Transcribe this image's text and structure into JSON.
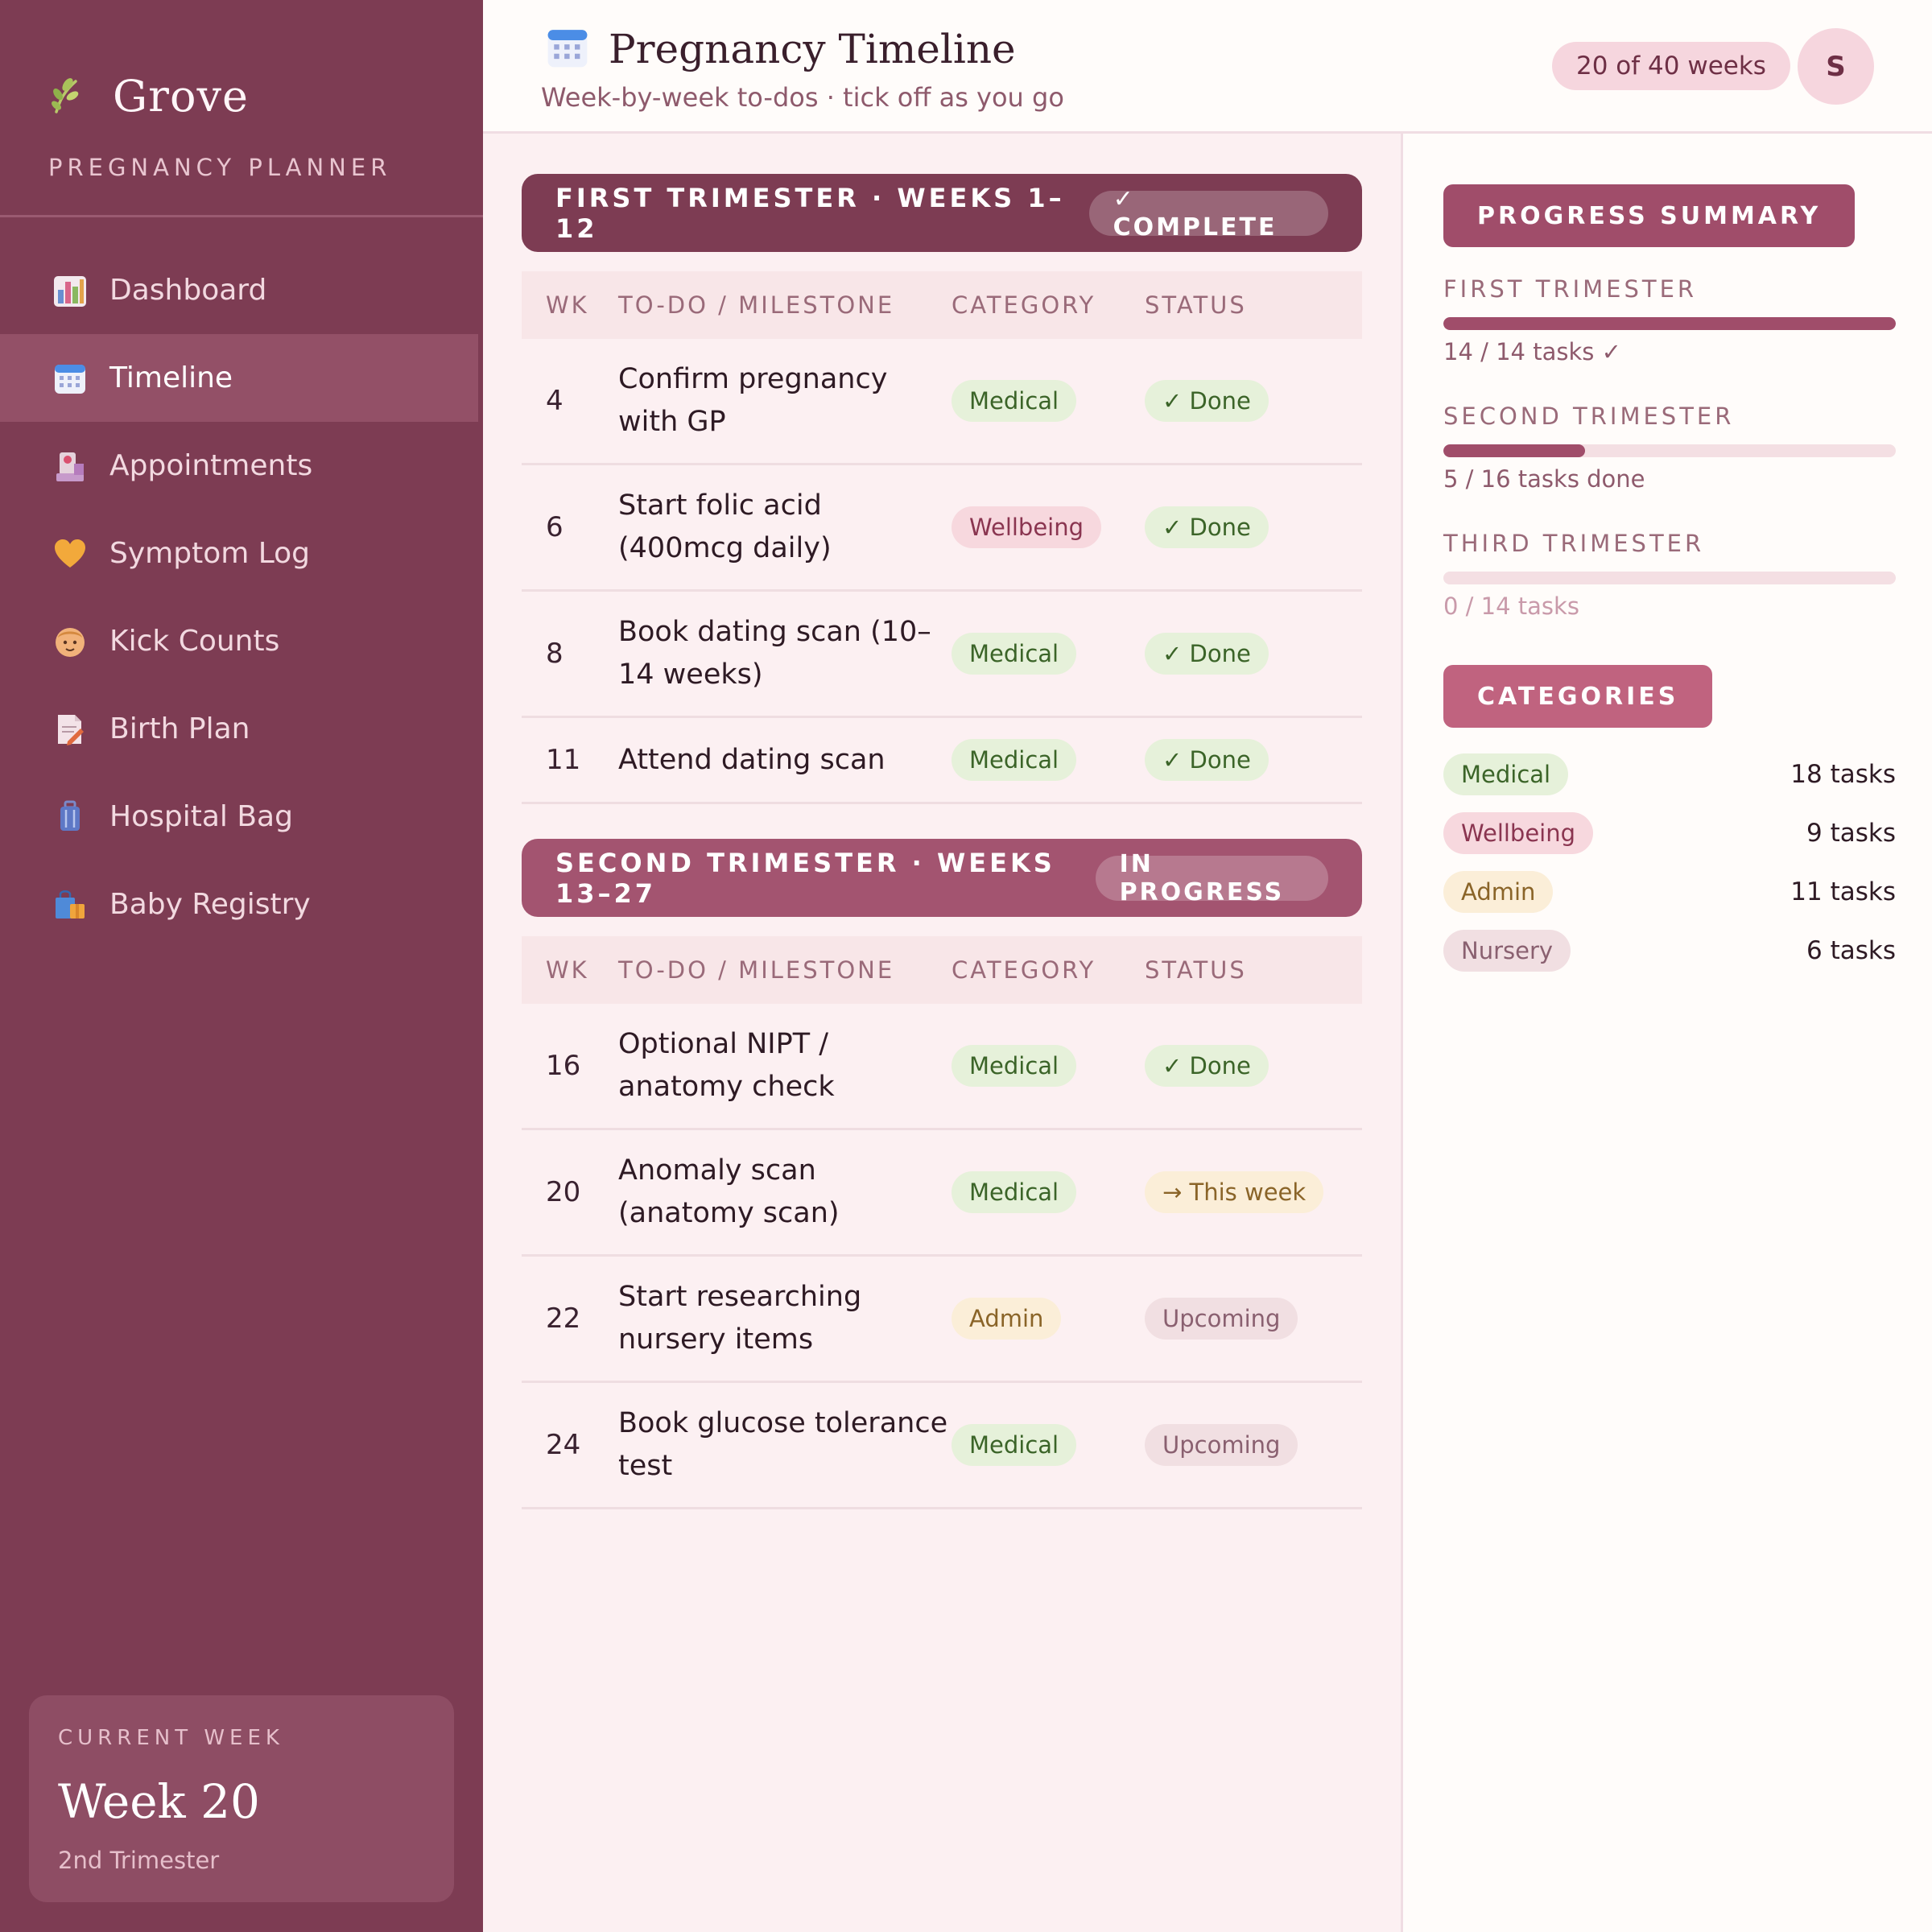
{
  "brand": {
    "name": "Grove",
    "subtitle": "PREGNANCY PLANNER"
  },
  "nav": [
    {
      "label": "Dashboard",
      "icon": "bar-chart-icon",
      "active": false
    },
    {
      "label": "Timeline",
      "icon": "calendar-icon",
      "active": true
    },
    {
      "label": "Appointments",
      "icon": "hospital-icon",
      "active": false
    },
    {
      "label": "Symptom Log",
      "icon": "heart-icon",
      "active": false
    },
    {
      "label": "Kick Counts",
      "icon": "baby-icon",
      "active": false
    },
    {
      "label": "Birth Plan",
      "icon": "memo-icon",
      "active": false
    },
    {
      "label": "Hospital Bag",
      "icon": "luggage-icon",
      "active": false
    },
    {
      "label": "Baby Registry",
      "icon": "shopping-bag-icon",
      "active": false
    }
  ],
  "current_week": {
    "label": "CURRENT WEEK",
    "value": "Week 20",
    "trimester": "2nd Trimester"
  },
  "header": {
    "title": "Pregnancy Timeline",
    "subtitle": "Week-by-week to-dos · tick off as you go",
    "weeks_pill": "20 of 40 weeks",
    "avatar": "S"
  },
  "table_headers": {
    "wk": "WK",
    "todo": "TO-DO / MILESTONE",
    "category": "CATEGORY",
    "status": "STATUS"
  },
  "trimesters": [
    {
      "title": "FIRST TRIMESTER · WEEKS 1–12",
      "badge": "✓ COMPLETE",
      "rows": [
        {
          "wk": "4",
          "todo": "Confirm pregnancy with GP",
          "category": "Medical",
          "status": "✓ Done"
        },
        {
          "wk": "6",
          "todo": "Start folic acid (400mcg daily)",
          "category": "Wellbeing",
          "status": "✓ Done"
        },
        {
          "wk": "8",
          "todo": "Book dating scan (10–14 weeks)",
          "category": "Medical",
          "status": "✓ Done"
        },
        {
          "wk": "11",
          "todo": "Attend dating scan",
          "category": "Medical",
          "status": "✓ Done"
        }
      ]
    },
    {
      "title": "SECOND TRIMESTER · WEEKS 13–27",
      "badge": "IN PROGRESS",
      "rows": [
        {
          "wk": "16",
          "todo": "Optional NIPT / anatomy check",
          "category": "Medical",
          "status": "✓ Done"
        },
        {
          "wk": "20",
          "todo": "Anomaly scan (anatomy scan)",
          "category": "Medical",
          "status": "→ This week"
        },
        {
          "wk": "22",
          "todo": "Start researching nursery items",
          "category": "Admin",
          "status": "Upcoming"
        },
        {
          "wk": "24",
          "todo": "Book glucose tolerance test",
          "category": "Medical",
          "status": "Upcoming"
        }
      ]
    }
  ],
  "progress": {
    "title": "PROGRESS SUMMARY",
    "items": [
      {
        "label": "FIRST TRIMESTER",
        "text": "14 / 14 tasks ✓",
        "fraction": 1.0
      },
      {
        "label": "SECOND TRIMESTER",
        "text": "5 / 16 tasks done",
        "fraction": 0.3125
      },
      {
        "label": "THIRD TRIMESTER",
        "text": "0 / 14 tasks",
        "fraction": 0
      }
    ]
  },
  "categories": {
    "title": "CATEGORIES",
    "items": [
      {
        "name": "Medical",
        "count": "18 tasks"
      },
      {
        "name": "Wellbeing",
        "count": "9 tasks"
      },
      {
        "name": "Admin",
        "count": "11 tasks"
      },
      {
        "name": "Nursery",
        "count": "6 tasks"
      }
    ]
  },
  "colors": {
    "sidebar": "#7d3c53",
    "accent": "#a35470",
    "medical": "#3b6428",
    "wellbeing": "#8a3550",
    "admin": "#8a6428",
    "nursery": "#8a6070"
  }
}
